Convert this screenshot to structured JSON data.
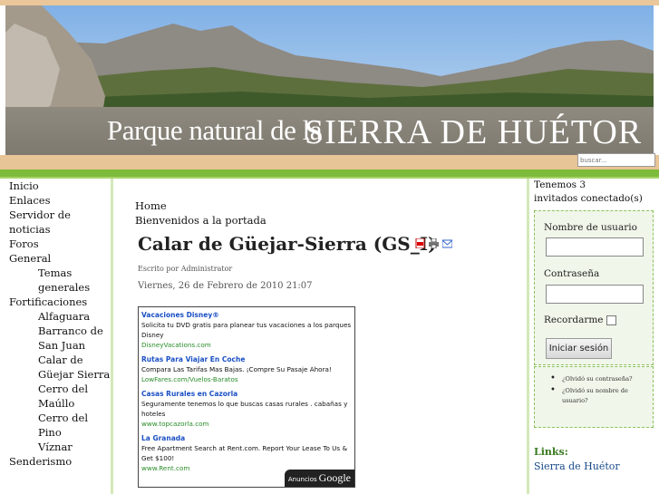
{
  "site": {
    "title_left": "Parque natural de la",
    "title_right": "SIERRA DE HUÉTOR"
  },
  "search": {
    "placeholder": "buscar..."
  },
  "left_menu": {
    "items": [
      {
        "label": "Inicio",
        "sub": false
      },
      {
        "label": "Enlaces",
        "sub": false
      },
      {
        "label": "Servidor de noticias",
        "sub": false
      },
      {
        "label": "Foros",
        "sub": false
      },
      {
        "label": "General",
        "sub": false
      },
      {
        "label": "Temas",
        "sub": true
      },
      {
        "label": "generales",
        "sub": true
      },
      {
        "label": "Fortificaciones",
        "sub": false
      },
      {
        "label": "Alfaguara",
        "sub": true
      },
      {
        "label": "Barranco de",
        "sub": true
      },
      {
        "label": "San Juan",
        "sub": true
      },
      {
        "label": "Calar de",
        "sub": true
      },
      {
        "label": "Güejar Sierra",
        "sub": true
      },
      {
        "label": "Cerro del",
        "sub": true
      },
      {
        "label": "Maúllo",
        "sub": true
      },
      {
        "label": "Cerro del Pino",
        "sub": true
      },
      {
        "label": "Víznar",
        "sub": true
      },
      {
        "label": "Senderismo",
        "sub": false
      }
    ]
  },
  "breadcrumb": {
    "home": "Home",
    "welcome": "Bienvenidos a la portada"
  },
  "article": {
    "title": "Calar de Güejar-Sierra (GS_I)",
    "author": "Escrito por Administrator",
    "date": "Viernes, 26 de Febrero de 2010 21:07",
    "icons": [
      "pdf-icon",
      "print-icon",
      "email-icon"
    ]
  },
  "ads": {
    "items": [
      {
        "title": "Vacaciones Disney®",
        "desc": "Solicita tu DVD gratis para planear tus vacaciones a los parques Disney",
        "url": "DisneyVacations.com"
      },
      {
        "title": "Rutas Para Viajar En Coche",
        "desc": "Compara Las Tarifas Mas Bajas. ¡Compre Su Pasaje Ahora!",
        "url": "LowFares.com/Vuelos-Baratos"
      },
      {
        "title": "Casas Rurales en Cazorla",
        "desc": "Seguramente tenemos lo que buscas casas rurales . cabañas y hoteles",
        "url": "www.topcazorla.com"
      },
      {
        "title": "La Granada",
        "desc": "Free Apartment Search at Rent.com. Report Your Lease To Us & Get $100!",
        "url": "www.Rent.com"
      }
    ],
    "badge_text": "Anuncios",
    "badge_brand": "Google"
  },
  "online": {
    "line1": "Tenemos 3",
    "line2": "invitados conectado(s)"
  },
  "login": {
    "username_label": "Nombre de usuario",
    "password_label": "Contraseña",
    "remember_label": "Recordarme",
    "submit_label": "Iniciar sesión",
    "links": [
      "¿Olvidó su contraseña?",
      "¿Olvidó su nombre de usuario?"
    ]
  },
  "links": {
    "heading": "Links:",
    "item": "Sierra de Huétor"
  },
  "colors": {
    "green_bar": "#7dbb3a",
    "tan": "#e8c596",
    "link_blue": "#1a4fc4"
  }
}
